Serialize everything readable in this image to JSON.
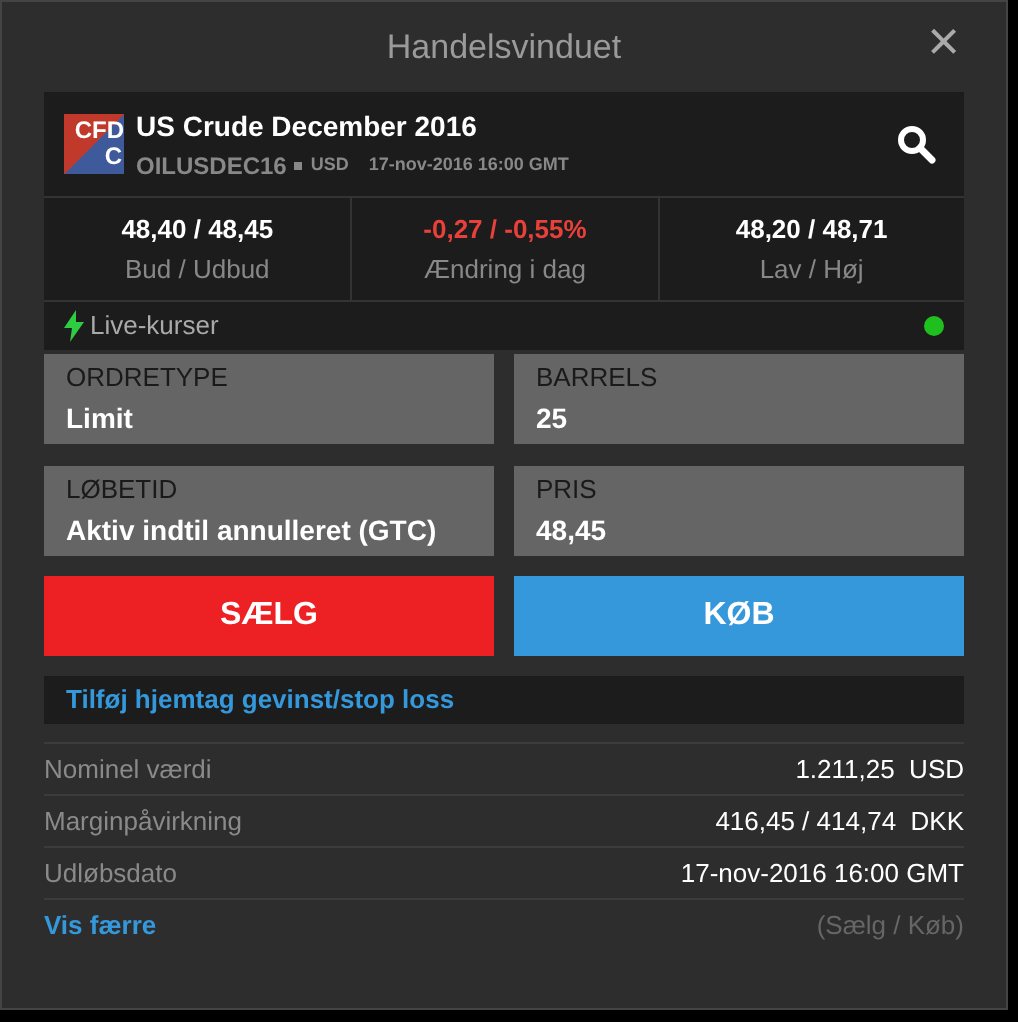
{
  "window": {
    "title": "Handelsvinduet",
    "close": "×"
  },
  "instrument": {
    "logo_top": "CFD",
    "logo_bottom": "C",
    "name": "US Crude December 2016",
    "symbol": "OILUSDEC16",
    "currency": "USD",
    "expiry": "17-nov-2016 16:00 GMT"
  },
  "quotes": [
    {
      "value": "48,40 / 48,45",
      "label": "Bud / Udbud",
      "kind": "neutral"
    },
    {
      "value": "-0,27 / -0,55%",
      "label": "Ændring i dag",
      "kind": "negative"
    },
    {
      "value": "48,20 / 48,71",
      "label": "Lav / Høj",
      "kind": "neutral"
    }
  ],
  "live": {
    "label": "Live-kurser",
    "on": true
  },
  "fields": [
    {
      "label": "ORDRETYPE",
      "value": "Limit"
    },
    {
      "label": "BARRELS",
      "value": "25"
    },
    {
      "label": "LØBETID",
      "value": "Aktiv indtil annulleret (GTC)"
    },
    {
      "label": "PRIS",
      "value": "48,45"
    }
  ],
  "buttons": [
    {
      "label": "SÆLG",
      "kind": "sell"
    },
    {
      "label": "KØB",
      "kind": "buy"
    }
  ],
  "stop_loss_link": "Tilføj hjemtag gevinst/stop loss",
  "details": [
    {
      "label": "Nominel værdi",
      "value": "1.211,25  USD"
    },
    {
      "label": "Marginpåvirkning",
      "value": "416,45 / 414,74  DKK"
    },
    {
      "label": "Udløbsdato",
      "value": "17-nov-2016 16:00 GMT"
    }
  ],
  "footer": {
    "link": "Vis færre",
    "note": "(Sælg / Køb)"
  }
}
